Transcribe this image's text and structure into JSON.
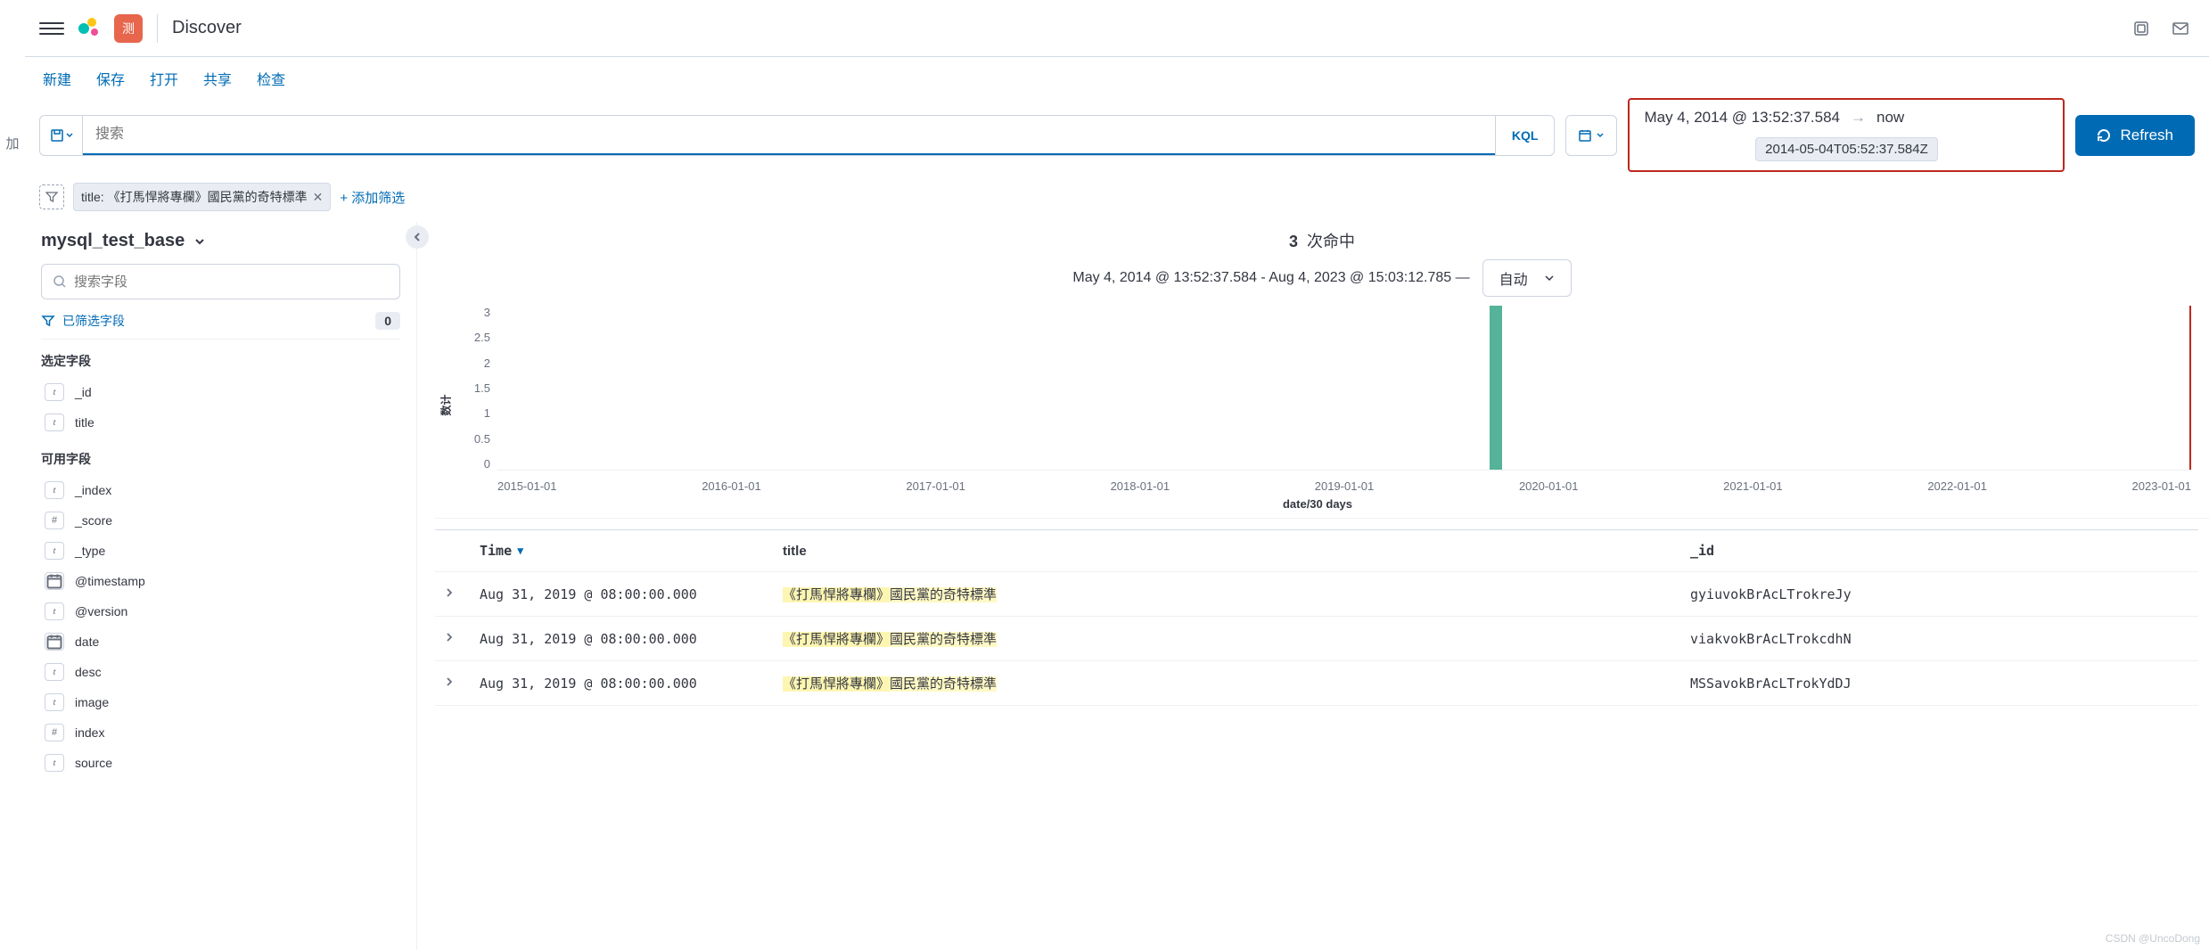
{
  "header": {
    "space_initial": "测",
    "app_title": "Discover"
  },
  "menubar": {
    "new": "新建",
    "save": "保存",
    "open": "打开",
    "share": "共享",
    "inspect": "检查"
  },
  "query": {
    "placeholder": "搜索",
    "language": "KQL",
    "date_from": "May 4, 2014 @ 13:52:37.584",
    "date_to": "now",
    "date_tooltip": "2014-05-04T05:52:37.584Z",
    "refresh": "Refresh"
  },
  "filters": {
    "chip_text": "title: 《打馬悍將專欄》國民黨的奇特標準",
    "add_filter": "+ 添加筛选"
  },
  "sidebar": {
    "index_pattern": "mysql_test_base",
    "field_search_placeholder": "搜索字段",
    "filtered_fields_label": "已筛选字段",
    "filtered_count": "0",
    "selected_label": "选定字段",
    "available_label": "可用字段",
    "selected": [
      {
        "type": "t",
        "name": "_id"
      },
      {
        "type": "t",
        "name": "title"
      }
    ],
    "available": [
      {
        "type": "t",
        "name": "_index"
      },
      {
        "type": "#",
        "name": "_score"
      },
      {
        "type": "t",
        "name": "_type"
      },
      {
        "type": "date",
        "name": "@timestamp"
      },
      {
        "type": "t",
        "name": "@version"
      },
      {
        "type": "date",
        "name": "date"
      },
      {
        "type": "t",
        "name": "desc"
      },
      {
        "type": "t",
        "name": "image"
      },
      {
        "type": "#",
        "name": "index"
      },
      {
        "type": "t",
        "name": "source"
      }
    ]
  },
  "results": {
    "hit_count": "3",
    "hit_label": "次命中",
    "range_text": "May 4, 2014 @ 13:52:37.584 - Aug 4, 2023 @ 15:03:12.785 —",
    "interval": "自动",
    "xlabel": "date/30 days",
    "ylabel": "数计",
    "columns": {
      "time": "Time",
      "title": "title",
      "id": "_id"
    },
    "rows": [
      {
        "time": "Aug 31, 2019 @ 08:00:00.000",
        "title_hl": "《打馬悍將專欄》",
        "title_rest": "國民黨的奇特標準",
        "id": "gyiuvokBrAcLTrokreJy"
      },
      {
        "time": "Aug 31, 2019 @ 08:00:00.000",
        "title_hl": "《打馬悍將專欄》",
        "title_rest": "國民黨的奇特標準",
        "id": "viakvokBrAcLTrokcdhN"
      },
      {
        "time": "Aug 31, 2019 @ 08:00:00.000",
        "title_hl": "《打馬悍將專欄》",
        "title_rest": "國民黨的奇特標準",
        "id": "MSSavokBrAcLTrokYdDJ"
      }
    ]
  },
  "chart_data": {
    "type": "bar",
    "categories": [
      "2015-01-01",
      "2016-01-01",
      "2017-01-01",
      "2018-01-01",
      "2019-01-01",
      "2020-01-01",
      "2021-01-01",
      "2022-01-01",
      "2023-01-01"
    ],
    "bars": [
      {
        "x_fraction": 0.586,
        "value": 3
      }
    ],
    "ylim": [
      0,
      3
    ],
    "yticks": [
      0,
      0.5,
      1,
      1.5,
      2,
      2.5,
      3
    ],
    "xlabel": "date/30 days",
    "ylabel": "数计",
    "title": ""
  },
  "left_edge_text": "加",
  "watermark": "CSDN @UncoDong"
}
